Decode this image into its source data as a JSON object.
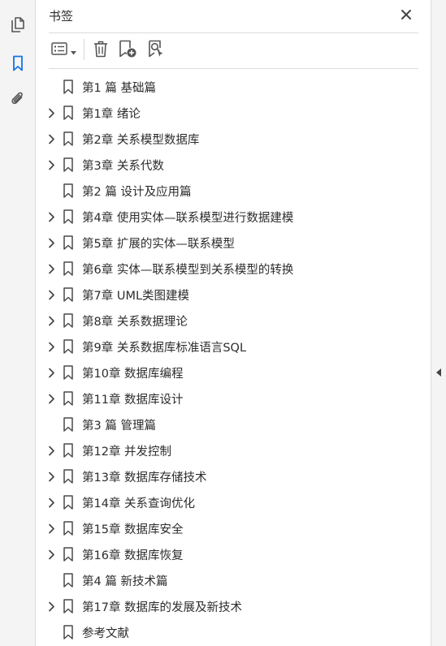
{
  "panel": {
    "title": "书签"
  },
  "rail": {
    "items": [
      {
        "icon": "pages-icon"
      },
      {
        "icon": "bookmark-icon",
        "active": true
      },
      {
        "icon": "attachment-icon"
      }
    ]
  },
  "toolbar": {
    "items": [
      "options-menu-icon",
      "delete-icon",
      "new-bookmark-icon",
      "find-bookmark-icon"
    ]
  },
  "bookmarks": [
    {
      "label": "第1 篇 基础篇",
      "expandable": false
    },
    {
      "label": "第1章 绪论",
      "expandable": true
    },
    {
      "label": "第2章 关系模型数据库",
      "expandable": true
    },
    {
      "label": "第3章 关系代数",
      "expandable": true
    },
    {
      "label": "第2 篇 设计及应用篇",
      "expandable": false
    },
    {
      "label": "第4章 使用实体—联系模型进行数据建模",
      "expandable": true
    },
    {
      "label": "第5章 扩展的实体—联系模型",
      "expandable": true
    },
    {
      "label": "第6章 实体—联系模型到关系模型的转换",
      "expandable": true
    },
    {
      "label": "第7章 UML类图建模",
      "expandable": true
    },
    {
      "label": "第8章 关系数据理论",
      "expandable": true
    },
    {
      "label": "第9章 关系数据库标准语言SQL",
      "expandable": true
    },
    {
      "label": "第10章 数据库编程",
      "expandable": true
    },
    {
      "label": "第11章 数据库设计",
      "expandable": true
    },
    {
      "label": "第3 篇 管理篇",
      "expandable": false
    },
    {
      "label": "第12章 并发控制",
      "expandable": true
    },
    {
      "label": "第13章 数据库存储技术",
      "expandable": true
    },
    {
      "label": "第14章 关系查询优化",
      "expandable": true
    },
    {
      "label": "第15章 数据库安全",
      "expandable": true
    },
    {
      "label": "第16章 数据库恢复",
      "expandable": true
    },
    {
      "label": "第4 篇 新技术篇",
      "expandable": false
    },
    {
      "label": "第17章 数据库的发展及新技术",
      "expandable": true
    },
    {
      "label": "参考文献",
      "expandable": false
    }
  ],
  "colors": {
    "accent": "#1473e6",
    "icon": "#555555",
    "text": "#2c2c2c"
  }
}
